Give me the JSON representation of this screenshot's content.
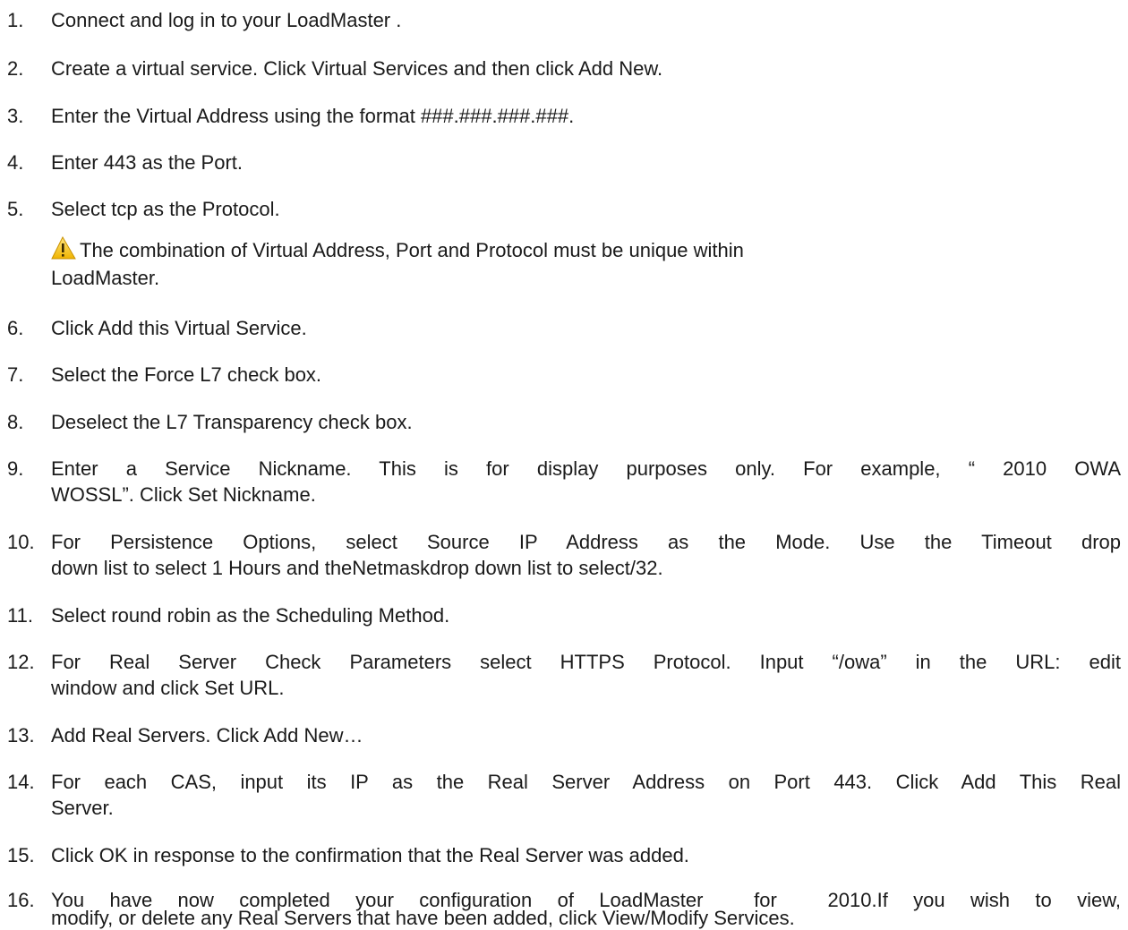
{
  "steps": [
    {
      "num": "1.",
      "lines": [
        "Connect and log in to your LoadMaster ."
      ]
    },
    {
      "num": "2.",
      "lines": [
        "Create a virtual service. Click Virtual Services and then click Add New."
      ]
    },
    {
      "num": "3.",
      "lines": [
        "Enter the Virtual Address using the format ###.###.###.###."
      ]
    },
    {
      "num": "4.",
      "lines": [
        "Enter 443 as the Port."
      ]
    },
    {
      "num": "5.",
      "lines": [
        "Select tcp as the Protocol."
      ]
    },
    {
      "num": "6.",
      "lines": [
        "Click Add this Virtual Service."
      ]
    },
    {
      "num": "7.",
      "lines": [
        "Select the Force L7 check box."
      ]
    },
    {
      "num": "8.",
      "lines": [
        "Deselect the L7 Transparency check box."
      ]
    },
    {
      "num": "9.",
      "lines": [
        "Enter a Service Nickname. This is for display purposes only. For example, “ 2010 OWA",
        "WOSSL”. Click Set Nickname."
      ]
    },
    {
      "num": "10.",
      "lines": [
        "For Persistence Options, select Source IP Address as the Mode. Use the Timeout drop",
        "down list to select 1 Hours and theNetmaskdrop down list to select/32."
      ]
    },
    {
      "num": "11.",
      "lines": [
        "Select round robin as the Scheduling Method."
      ]
    },
    {
      "num": "12.",
      "lines": [
        "For Real Server Check Parameters select HTTPS Protocol. Input “/owa” in the URL: edit",
        "window and click Set URL."
      ]
    },
    {
      "num": "13.",
      "lines": [
        "Add Real Servers. Click Add New…"
      ]
    },
    {
      "num": "14.",
      "lines": [
        "For each CAS, input its IP as the Real Server Address on Port 443. Click Add This Real",
        "Server."
      ]
    },
    {
      "num": "15.",
      "lines": [
        "Click OK in response to the confirmation that the Real Server was added."
      ]
    },
    {
      "num": "16.",
      "lines": [
        "You have now completed your configuration of LoadMaster  for  2010.If you wish to view,",
        "modify, or delete any Real Servers that have been added, click View/Modify Services."
      ]
    }
  ],
  "note": {
    "icon": "warning-icon",
    "line1": "The combination of Virtual Address, Port and Protocol must be unique within",
    "line2": "LoadMaster."
  },
  "colors": {
    "text": "#1a1a1a",
    "warning_fill": "#f5c518",
    "warning_mark": "#5a4000"
  }
}
